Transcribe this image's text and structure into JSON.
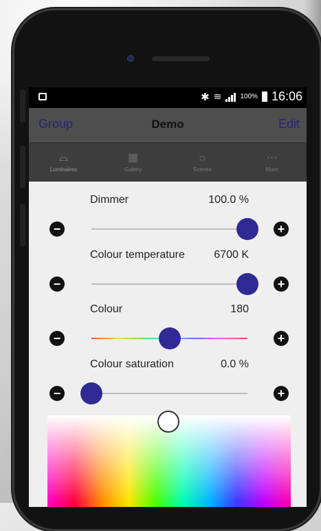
{
  "status_bar": {
    "battery_percent": "100%",
    "time": "16:06"
  },
  "header": {
    "left": "Group",
    "title": "Demo",
    "right": "Edit"
  },
  "tabs": [
    {
      "label": "Luminaires",
      "icon": "luminaire-icon",
      "active": true
    },
    {
      "label": "Gallery",
      "icon": "grid-icon",
      "active": false
    },
    {
      "label": "Scenes",
      "icon": "sun-icon",
      "active": false
    },
    {
      "label": "More",
      "icon": "more-icon",
      "active": false
    }
  ],
  "sliders": [
    {
      "label": "Dimmer",
      "value": "100.0 %",
      "position": 1.0
    },
    {
      "label": "Colour temperature",
      "value": "6700 K",
      "position": 1.0
    },
    {
      "label": "Colour",
      "value": "180",
      "position": 0.5
    },
    {
      "label": "Colour saturation",
      "value": "0.0 %",
      "position": 0.0
    }
  ],
  "buttons": {
    "minus": "−",
    "plus": "+"
  },
  "colors": {
    "accent": "#2f2a94",
    "header_bg": "#4e4e4e",
    "tabbar_bg": "#3d3d3d"
  }
}
